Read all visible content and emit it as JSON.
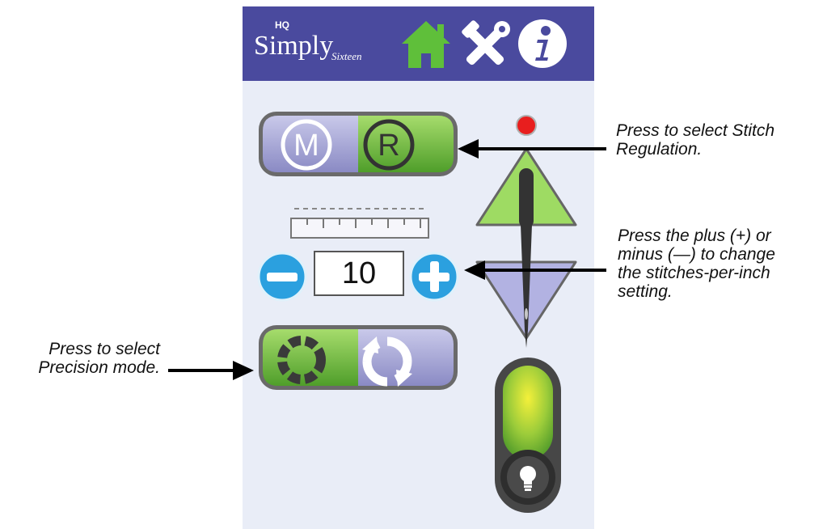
{
  "app": {
    "logo_main": "Simply",
    "logo_hq": "HQ",
    "logo_sub": "Sixteen"
  },
  "header": {
    "buttons": [
      {
        "name": "home",
        "icon": "home-icon",
        "color": "#5fbf3a"
      },
      {
        "name": "tools",
        "icon": "tools-icon",
        "color": "#ffffff"
      },
      {
        "name": "info",
        "icon": "info-icon",
        "color": "#ffffff"
      }
    ]
  },
  "mode_toggle": {
    "options": [
      "M",
      "R"
    ],
    "selected": "R"
  },
  "stitch": {
    "value": "10"
  },
  "cycle_toggle": {
    "options": [
      "precision-icon",
      "cycle-icon"
    ],
    "selected": "precision-icon"
  },
  "needle_indicator_color": "#e81e1e",
  "colors": {
    "header_bg": "#4a4a9e",
    "screen_bg": "#e9edf7",
    "green": "#6fbf3f",
    "lavender": "#9a9ad0",
    "plus_minus_blue": "#2ba0df"
  },
  "callouts": {
    "stitch_regulation": [
      "Press to select Stitch",
      "Regulation."
    ],
    "spi": [
      "Press the plus (+) or",
      "minus (—) to change",
      "the stitches-per-inch",
      "setting."
    ],
    "precision": [
      "Press to select",
      "Precision mode."
    ]
  }
}
